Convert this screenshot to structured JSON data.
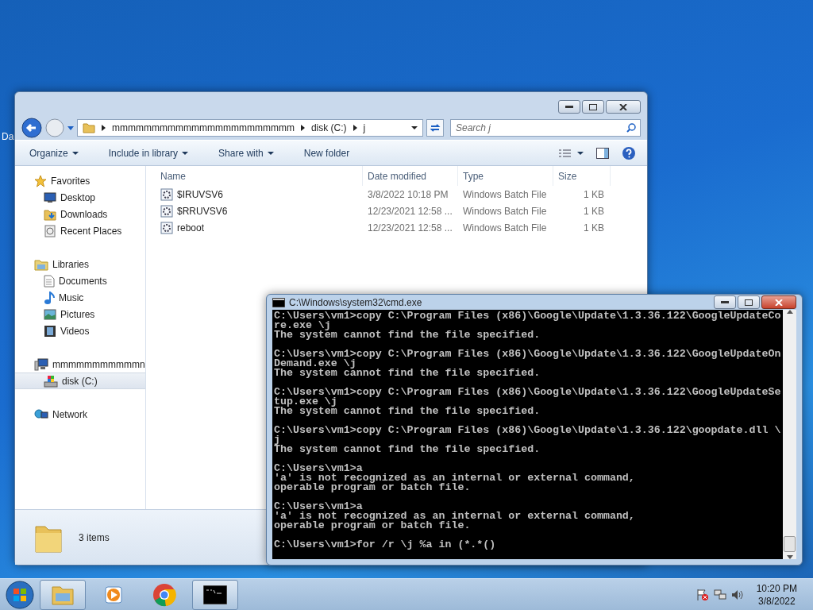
{
  "desktop": {
    "icon_label": "Da"
  },
  "explorer": {
    "address": {
      "segments": [
        "mmmmmmmmmmmmmmmmmmmmmmm",
        "disk (C:)",
        "j"
      ]
    },
    "search": {
      "placeholder": "Search j"
    },
    "toolbar": [
      {
        "label": "Organize",
        "dropdown": true
      },
      {
        "label": "Include in library",
        "dropdown": true
      },
      {
        "label": "Share with",
        "dropdown": true
      },
      {
        "label": "New folder",
        "dropdown": false
      }
    ],
    "sidebar": [
      {
        "label": "Favorites",
        "children": [
          {
            "label": "Desktop",
            "selected": false
          },
          {
            "label": "Downloads",
            "selected": false
          },
          {
            "label": "Recent Places",
            "selected": false
          }
        ]
      },
      {
        "label": "Libraries",
        "children": [
          {
            "label": "Documents",
            "selected": false
          },
          {
            "label": "Music",
            "selected": false
          },
          {
            "label": "Pictures",
            "selected": false
          },
          {
            "label": "Videos",
            "selected": false
          }
        ]
      },
      {
        "label": "mmmmmmmmmmmn",
        "children": [
          {
            "label": "disk (C:)",
            "selected": true
          }
        ]
      },
      {
        "label": "Network"
      }
    ],
    "columns": [
      "Name",
      "Date modified",
      "Type",
      "Size"
    ],
    "rows": [
      {
        "name": "$IRUVSV6",
        "date": "3/8/2022 10:18 PM",
        "type": "Windows Batch File",
        "size": "1 KB"
      },
      {
        "name": "$RRUVSV6",
        "date": "12/23/2021 12:58 ...",
        "type": "Windows Batch File",
        "size": "1 KB"
      },
      {
        "name": "reboot",
        "date": "12/23/2021 12:58 ...",
        "type": "Windows Batch File",
        "size": "1 KB"
      }
    ],
    "status": "3 items"
  },
  "console": {
    "title": "C:\\Windows\\system32\\cmd.exe",
    "blocks": [
      [
        "C:\\Users\\vm1>copy C:\\Program Files (x86)\\Google\\Update\\1.3.36.122\\GoogleUpdateCo",
        "re.exe \\j",
        "The system cannot find the file specified."
      ],
      [
        "C:\\Users\\vm1>copy C:\\Program Files (x86)\\Google\\Update\\1.3.36.122\\GoogleUpdateOn",
        "Demand.exe \\j",
        "The system cannot find the file specified."
      ],
      [
        "C:\\Users\\vm1>copy C:\\Program Files (x86)\\Google\\Update\\1.3.36.122\\GoogleUpdateSe",
        "tup.exe \\j",
        "The system cannot find the file specified."
      ],
      [
        "C:\\Users\\vm1>copy C:\\Program Files (x86)\\Google\\Update\\1.3.36.122\\goopdate.dll \\",
        "j",
        "The system cannot find the file specified."
      ],
      [
        "C:\\Users\\vm1>a",
        "'a' is not recognized as an internal or external command,",
        "operable program or batch file."
      ],
      [
        "C:\\Users\\vm1>a",
        "'a' is not recognized as an internal or external command,",
        "operable program or batch file."
      ],
      [
        "C:\\Users\\vm1>for /r \\j %a in (*.*()"
      ]
    ]
  },
  "taskbar": {
    "apps": [
      {
        "kind": "explorer",
        "selected": true
      },
      {
        "kind": "media",
        "selected": false
      },
      {
        "kind": "browser",
        "selected": false
      },
      {
        "kind": "console",
        "selected": true
      }
    ],
    "time": "10:20 PM",
    "date": "3/8/2022"
  }
}
